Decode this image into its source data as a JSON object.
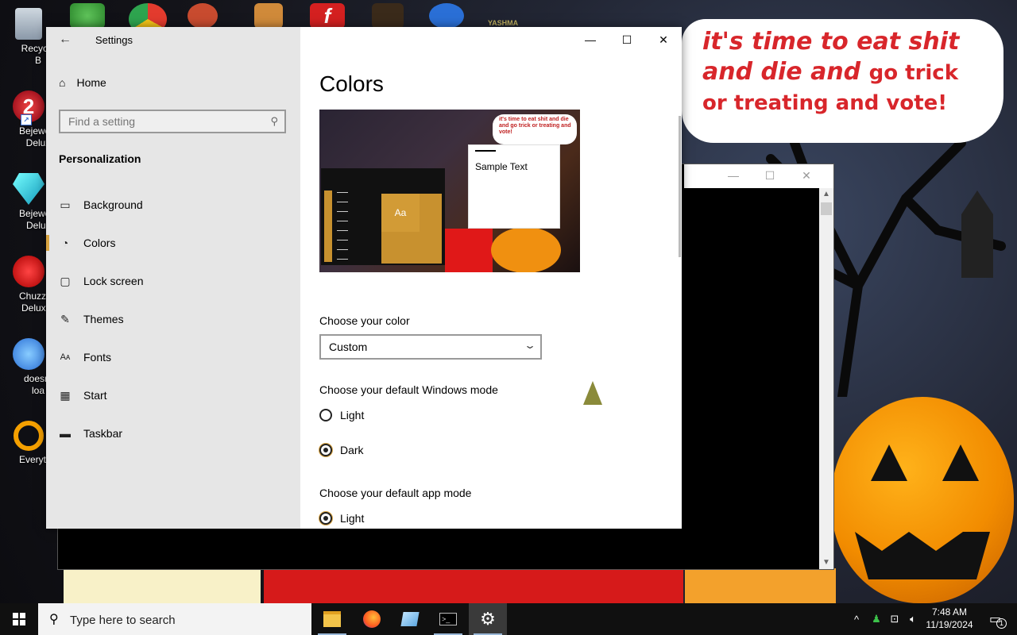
{
  "desktop": {
    "speech_bubble": {
      "line1": "it's time to eat shit",
      "line2a": "and die and",
      "line2b": "go trick",
      "line3": "or treating and vote!"
    },
    "top_strip_text": "YASHMA",
    "icons": [
      {
        "label": "Recycle B",
        "icon": "recycle-bin-icon"
      },
      {
        "label": "Bejewelec\nDeluxe",
        "icon": "bejeweled2-icon"
      },
      {
        "label": "Bejeweled\nDeluxe",
        "icon": "bejeweled-gem-icon"
      },
      {
        "label": "Chuzzle\nDeluxe",
        "icon": "chuzzle-icon"
      },
      {
        "label": "doesnt loa",
        "icon": "thunderbird-icon"
      },
      {
        "label": "Everythin",
        "icon": "everything-search-icon"
      }
    ]
  },
  "settings": {
    "window_title": "Settings",
    "nav": {
      "home_label": "Home",
      "search_placeholder": "Find a setting",
      "section_title": "Personalization",
      "items": [
        {
          "label": "Background",
          "icon": "picture-icon"
        },
        {
          "label": "Colors",
          "icon": "palette-icon",
          "active": true
        },
        {
          "label": "Lock screen",
          "icon": "lock-screen-icon"
        },
        {
          "label": "Themes",
          "icon": "themes-brush-icon"
        },
        {
          "label": "Fonts",
          "icon": "fonts-icon"
        },
        {
          "label": "Start",
          "icon": "start-grid-icon"
        },
        {
          "label": "Taskbar",
          "icon": "taskbar-icon"
        }
      ]
    },
    "content": {
      "page_title": "Colors",
      "preview": {
        "sample_text": "Sample Text",
        "tile_text": "Aa",
        "bubble_text": "it's time to eat shit and die and go trick or treating and vote!"
      },
      "choose_color_label": "Choose your color",
      "choose_color_value": "Custom",
      "windows_mode_label": "Choose your default Windows mode",
      "windows_mode_options": [
        {
          "label": "Light",
          "selected": false
        },
        {
          "label": "Dark",
          "selected": true
        }
      ],
      "app_mode_label": "Choose your default app mode",
      "app_mode_options": [
        {
          "label": "Light",
          "selected": true
        }
      ]
    },
    "accent_color": "#d9a441"
  },
  "taskbar": {
    "search_placeholder": "Type here to search",
    "apps": [
      {
        "name": "file-explorer-icon"
      },
      {
        "name": "firefox-icon"
      },
      {
        "name": "tablet-app-icon"
      },
      {
        "name": "terminal-icon"
      },
      {
        "name": "settings-gear-icon",
        "active": true
      }
    ],
    "clock_time": "7:48 AM",
    "clock_date": "11/19/2024",
    "notification_count": "1"
  }
}
